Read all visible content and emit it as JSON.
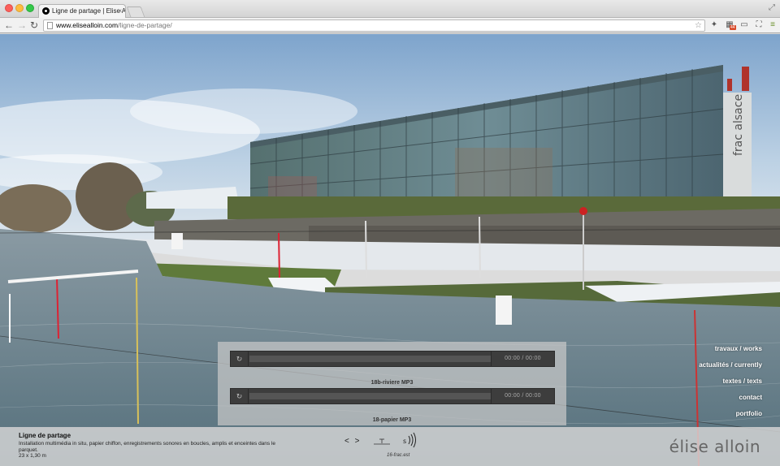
{
  "browser": {
    "tab_title": "Ligne de partage | Elise Al",
    "tab_close": "×",
    "url_domain": "www.elisealloin.com",
    "url_path": "/ligne-de-partage/",
    "extension_badge": "44"
  },
  "icons": {
    "back": "←",
    "forward": "→",
    "reload": "↻",
    "star": "☆",
    "menu": "≡",
    "resize": "⤢",
    "play": "↻"
  },
  "player": {
    "tracks": [
      {
        "time": "00:00 / 00:00",
        "label": "18b-riviere MP3"
      },
      {
        "time": "00:00 / 00:00",
        "label": "18-papier MP3"
      }
    ]
  },
  "nav": {
    "items": [
      "travaux / works",
      "actualités / currently",
      "textes / texts",
      "contact",
      "portfolio"
    ]
  },
  "info": {
    "title": "Ligne de partage",
    "description": "Installation multimédia in situ, papier chiffon, enregistrements sonores en boucles, amplis et enceintes dans le parquet.",
    "dimensions": "23 x 1,30 m",
    "arrows": "< >",
    "credit": "16-frac.est",
    "brand": "élise alloin"
  },
  "colors": {
    "sky": "#a9c4dd",
    "water": "#6f8591",
    "panel": "#c8c8c8",
    "track": "#3d3d3d"
  }
}
